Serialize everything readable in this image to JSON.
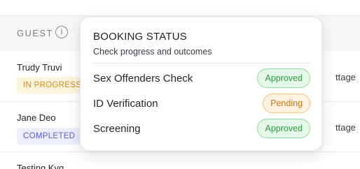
{
  "table": {
    "header": {
      "guest_label": "GUEST",
      "info_icon": "i"
    },
    "rows": [
      {
        "name": "Trudy Truvi",
        "status": "IN PROGRESS",
        "right_text": "ttage"
      },
      {
        "name": "Jane Deo",
        "status": "COMPLETED",
        "right_text": "ttage"
      },
      {
        "name": "Testing Kyg",
        "status": "",
        "right_text": ""
      }
    ],
    "status_colors": {
      "in_progress_text": "#d88a16",
      "in_progress_bg": "#fff5df",
      "completed_text": "#5a5fd6",
      "completed_bg": "#eceefe"
    }
  },
  "popover": {
    "title": "BOOKING STATUS",
    "subtitle": "Check progress and outcomes",
    "checks": [
      {
        "label": "Sex Offenders Check",
        "status": "Approved",
        "tone": "approved"
      },
      {
        "label": "ID Verification",
        "status": "Pending",
        "tone": "pending"
      },
      {
        "label": "Screening",
        "status": "Approved",
        "tone": "approved"
      }
    ],
    "colors": {
      "approved_text": "#2e9c3e",
      "approved_bg": "#e6f8e8",
      "approved_border": "#8fdc98",
      "pending_text": "#cc7c14",
      "pending_bg": "#fff1e0",
      "pending_border": "#f4c07a"
    }
  }
}
